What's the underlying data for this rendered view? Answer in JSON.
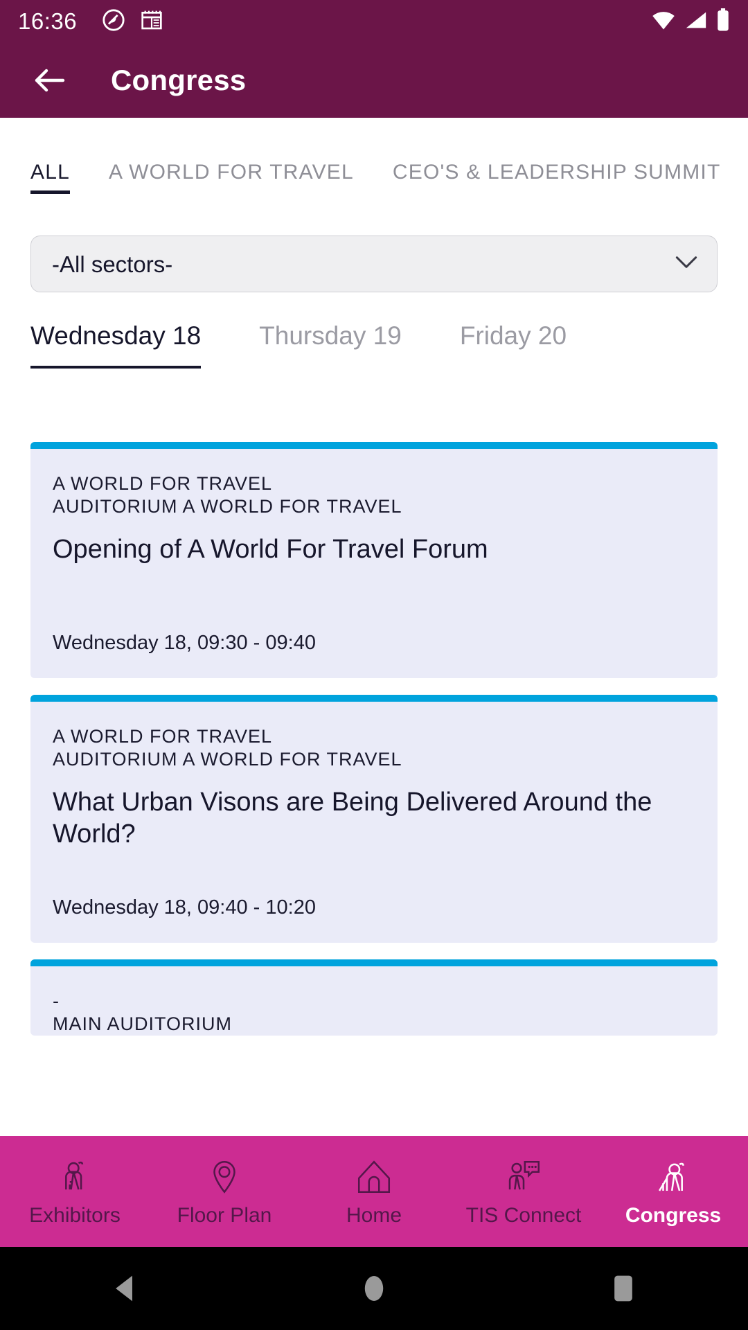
{
  "status_bar": {
    "time": "16:36",
    "icons": [
      "do-not-disturb-icon",
      "calendar-note-icon"
    ],
    "right_icons": [
      "wifi-icon",
      "signal-icon",
      "battery-icon"
    ]
  },
  "app_bar": {
    "back_icon": "back-arrow-icon",
    "title": "Congress"
  },
  "category_tabs": [
    {
      "label": "ALL",
      "active": true
    },
    {
      "label": "A WORLD FOR TRAVEL",
      "active": false
    },
    {
      "label": "CEO'S & LEADERSHIP SUMMIT",
      "active": false
    }
  ],
  "sector_select": {
    "value": "-All sectors-",
    "options": [
      "-All sectors-"
    ],
    "chevron_icon": "chevron-down-icon"
  },
  "day_tabs": [
    {
      "label": "Wednesday 18",
      "active": true
    },
    {
      "label": "Thursday 19",
      "active": false
    },
    {
      "label": "Friday 20",
      "active": false
    }
  ],
  "sessions": [
    {
      "track": "A WORLD FOR TRAVEL",
      "room": "AUDITORIUM A WORLD FOR TRAVEL",
      "title": "Opening of A World For Travel Forum",
      "time": "Wednesday 18, 09:30 - 09:40",
      "accent_color": "#00A3DD"
    },
    {
      "track": "A WORLD FOR TRAVEL",
      "room": "AUDITORIUM A WORLD FOR TRAVEL",
      "title": "What Urban Visons are Being Delivered Around the World?",
      "time": "Wednesday 18, 09:40 - 10:20",
      "accent_color": "#00A3DD"
    },
    {
      "track": "-",
      "room": "MAIN AUDITORIUM",
      "title": "",
      "time": "",
      "accent_color": "#00A3DD"
    }
  ],
  "bottom_nav": [
    {
      "label": "Exhibitors",
      "icon": "exhibitor-person-icon",
      "active": false
    },
    {
      "label": "Floor Plan",
      "icon": "map-pin-icon",
      "active": false
    },
    {
      "label": "Home",
      "icon": "home-icon",
      "active": false
    },
    {
      "label": "TIS Connect",
      "icon": "people-chat-icon",
      "active": false
    },
    {
      "label": "Congress",
      "icon": "speaker-person-icon",
      "active": true
    }
  ],
  "android_nav": {
    "back": "android-back-icon",
    "home": "android-home-icon",
    "recents": "android-recents-icon"
  },
  "colors": {
    "brand_purple": "#6B1548",
    "nav_pink": "#CC2C92",
    "card_bg": "#EAEBF8",
    "card_accent": "#00A3DD",
    "text_dark": "#16162B",
    "text_muted": "#9B9BA3"
  }
}
